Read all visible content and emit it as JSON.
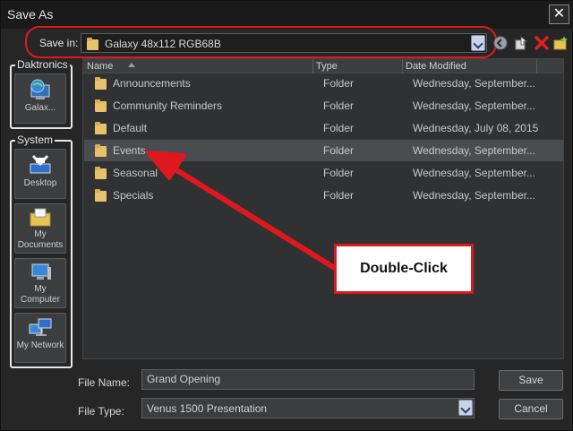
{
  "window": {
    "title": "Save As"
  },
  "save_in": {
    "label": "Save in:",
    "value": "Galaxy 48x112 RGB68B"
  },
  "toolbar": {
    "back_icon": "back-icon",
    "up_icon": "up-folder-icon",
    "delete_icon": "delete-icon",
    "new_folder_icon": "new-folder-icon"
  },
  "sidebar": {
    "groups": [
      {
        "label": "Daktronics",
        "items": [
          {
            "label": "Galax...",
            "icon": "globe-computer-icon"
          }
        ]
      },
      {
        "label": "System",
        "items": [
          {
            "label": "Desktop",
            "icon": "desktop-icon"
          },
          {
            "label_line1": "My",
            "label_line2": "Documents",
            "icon": "documents-folder-icon"
          },
          {
            "label_line1": "My",
            "label_line2": "Computer",
            "icon": "computer-icon"
          },
          {
            "label": "My Network",
            "icon": "network-icon"
          }
        ]
      }
    ]
  },
  "list": {
    "columns": {
      "name": "Name",
      "type": "Type",
      "date": "Date Modified"
    },
    "rows": [
      {
        "name": "Announcements",
        "type": "Folder",
        "date": "Wednesday, September..."
      },
      {
        "name": "Community Reminders",
        "type": "Folder",
        "date": "Wednesday, September..."
      },
      {
        "name": "Default",
        "type": "Folder",
        "date": "Wednesday, July 08, 2015"
      },
      {
        "name": "Events",
        "type": "Folder",
        "date": "Wednesday, September..."
      },
      {
        "name": "Seasonal",
        "type": "Folder",
        "date": "Wednesday, September..."
      },
      {
        "name": "Specials",
        "type": "Folder",
        "date": "Wednesday, September..."
      }
    ],
    "selected_row": "Events"
  },
  "annotation": {
    "callout_text": "Double-Click",
    "color": "#e0181e"
  },
  "file_name": {
    "label": "File Name:",
    "value": "Grand Opening"
  },
  "file_type": {
    "label": "File Type:",
    "value": "Venus 1500 Presentation"
  },
  "buttons": {
    "save": "Save",
    "cancel": "Cancel"
  }
}
